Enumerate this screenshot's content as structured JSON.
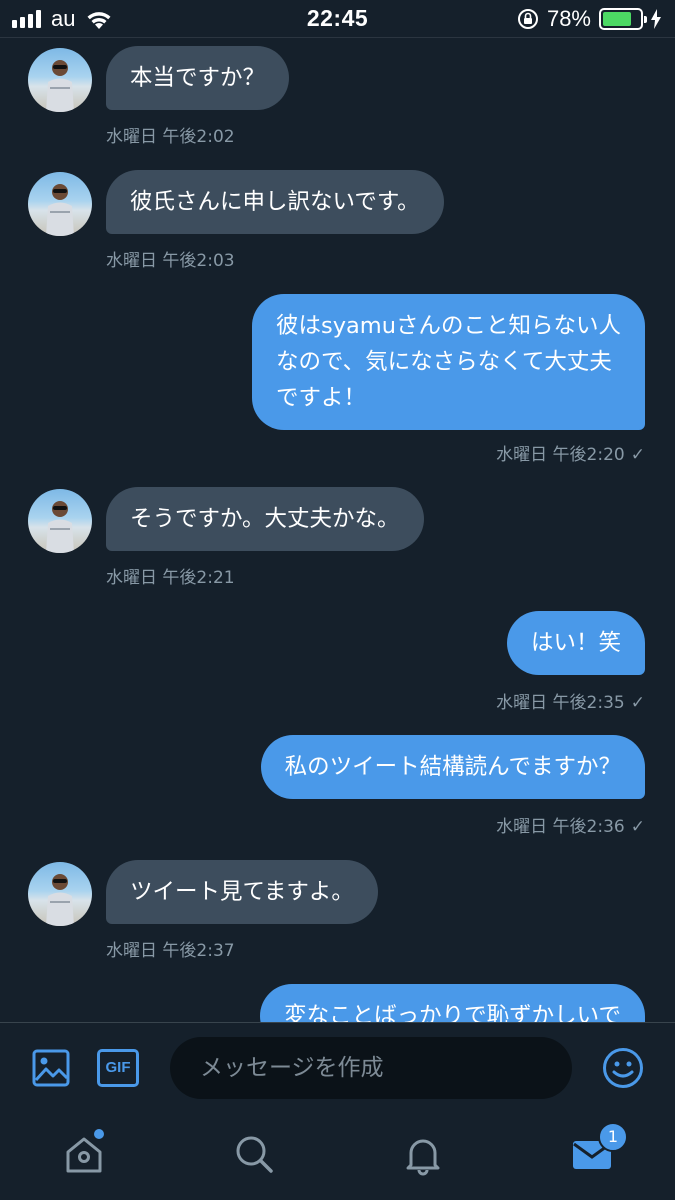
{
  "status_bar": {
    "carrier": "au",
    "time": "22:45",
    "battery_percent": "78%",
    "battery_level": 0.78
  },
  "messages": [
    {
      "direction": "received",
      "text": "本当ですか？",
      "timestamp": "水曜日 午後2:02"
    },
    {
      "direction": "received",
      "text": "彼氏さんに申し訳ないです。",
      "timestamp": "水曜日 午後2:03"
    },
    {
      "direction": "sent",
      "lines": [
        "彼はsyamuさんのこと知らない人",
        "なので、気になさらなくて大丈夫",
        "ですよ！"
      ],
      "timestamp": "水曜日 午後2:20",
      "read_icon": "check-icon"
    },
    {
      "direction": "received",
      "text": "そうですか。大丈夫かな。",
      "timestamp": "水曜日 午後2:21"
    },
    {
      "direction": "sent",
      "text": "はい！笑",
      "timestamp": "水曜日 午後2:35",
      "read_icon": "check-icon"
    },
    {
      "direction": "sent",
      "text": "私のツイート結構読んでますか？",
      "timestamp": "水曜日 午後2:36",
      "read_icon": "check-icon"
    },
    {
      "direction": "received",
      "text": "ツイート見てますよ。",
      "timestamp": "水曜日 午後2:37"
    },
    {
      "direction": "sent",
      "text": "変なことばっかりで恥ずかしいで",
      "timestamp": ""
    }
  ],
  "composer": {
    "placeholder": "メッセージを作成",
    "gif_label": "GIF",
    "icons": [
      "image-icon",
      "gif-icon",
      "emoji-icon"
    ]
  },
  "tab_bar": {
    "tabs": [
      "home-icon",
      "search-icon",
      "notifications-icon",
      "messages-icon"
    ],
    "messages_badge": "1",
    "active_tab": "messages"
  },
  "colors": {
    "background": "#15202b",
    "received_bubble": "#3d4d5d",
    "sent_bubble": "#4a99e9",
    "timestamp": "#8899a6",
    "accent": "#4a99e9",
    "battery": "#4cd964"
  }
}
